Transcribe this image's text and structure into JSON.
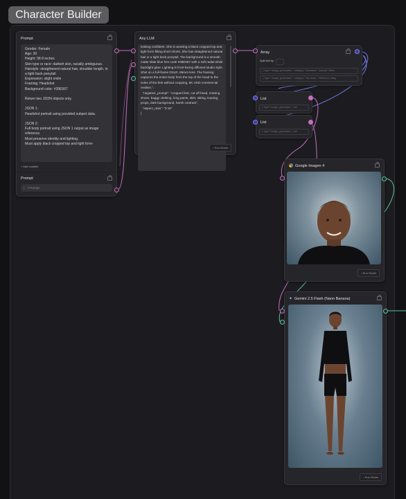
{
  "title": "Character Builder",
  "prompt1": {
    "header": "Prompt",
    "text": "Gender: Female\nAge: 30\nHeight: 5ft 8 inches\nSkin type or race: darkish skin, racially ambiguous.\nHairstyle: straightened natural hair, shoulder length, in a tight back ponytail.\nExpression: slight smile\nFraming: Headshot\nBackground color: #39E567\n\nReturn two JSON objects only.\n\nJSON 1:\nHeadshot portrait using provided subject data.\n\nJSON 2:\nFull body portrait using JSON 1 output as image reference.\nMust preserve identity and lighting.\nMust apply black cropped top and tight form-",
    "add_variable": "Add variable"
  },
  "prompt2": {
    "header": "Prompt",
    "placeholder": "{ · } Prompt"
  },
  "llm": {
    "header": "Any LLM",
    "text": "looking confident. She is wearing a black cropped top and tight form-fitting short shorts. She has straightened natural hair in a tight back ponytail. The background is a smooth matte slate blue hex code #39E567 with a soft radial white backlight glow. Lighting is front-facing diffused studio style. Shot on a full-frame DSLR, 85mm lens. The framing captures the entire body from the top of the head to the soles of the feet without cropping, 8K UHD commercial realism.\",\n  \"negative_prompt\": \"cropped feet, cut off head, missing shoes, baggy clothing, long pants, skirt, sitting, leaning, props, dark background, harsh contrast\",\n  \"aspect_ratio\": \"9:16\"\n}",
    "run": "Run Model"
  },
  "array": {
    "header": "Array",
    "split_label": "Split text by:",
    "split_value": ",",
    "row1": "{ \"type\":\"image_generation\", \"category\":\"headshot\", \"prompt\":\"Wom",
    "row2": "{ \"type\":\"image_generation\", \"category\":\"full_body\", \"reference_imag"
  },
  "list1": {
    "header": "List",
    "value": "{ \"type\":\"image_generation\", \"cat"
  },
  "list2": {
    "header": "List",
    "value": "{ \"type\":\"image_generation\", \"cat"
  },
  "imagen": {
    "header": "Google Imagen 4",
    "run": "Run Model"
  },
  "gemini": {
    "header": "Gemini 2.5 Flash (Nano Banana)",
    "run": "Run Model"
  },
  "colors": {
    "wire_pink": "#c86ec0",
    "wire_blue": "#7a7ef0",
    "wire_green": "#5bc4a0",
    "backdrop_blue": "#3d5566"
  }
}
